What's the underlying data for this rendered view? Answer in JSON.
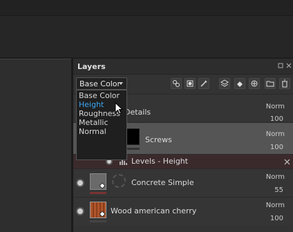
{
  "panel": {
    "title": "Layers"
  },
  "channel_dropdown": {
    "selected": "Base Color",
    "options": [
      "Base Color",
      "Height",
      "Roughness",
      "Metallic",
      "Normal"
    ],
    "highlighted": "Height"
  },
  "layers": [
    {
      "name": "Details",
      "blend": "Norm",
      "opacity": "100"
    },
    {
      "name": "Screws",
      "blend": "Norm",
      "opacity": "100"
    },
    {
      "name": "Levels - Height"
    },
    {
      "name": "Concrete Simple",
      "blend": "Norm",
      "opacity": "55"
    },
    {
      "name": "Wood american cherry",
      "blend": "Norm",
      "opacity": "100"
    }
  ],
  "colors": {
    "highlight": "#3aa6f0",
    "selected_row": "#555555",
    "filter_row": "#3b2a2c",
    "wood": "#b0542a"
  },
  "icons": [
    "float-icon",
    "close-icon",
    "add-fill-layer-icon",
    "add-mask-icon",
    "paint-icon",
    "add-layer-icon",
    "fill-icon",
    "smart-material-icon",
    "folder-icon",
    "delete-icon",
    "levels-icon",
    "remove-icon"
  ]
}
